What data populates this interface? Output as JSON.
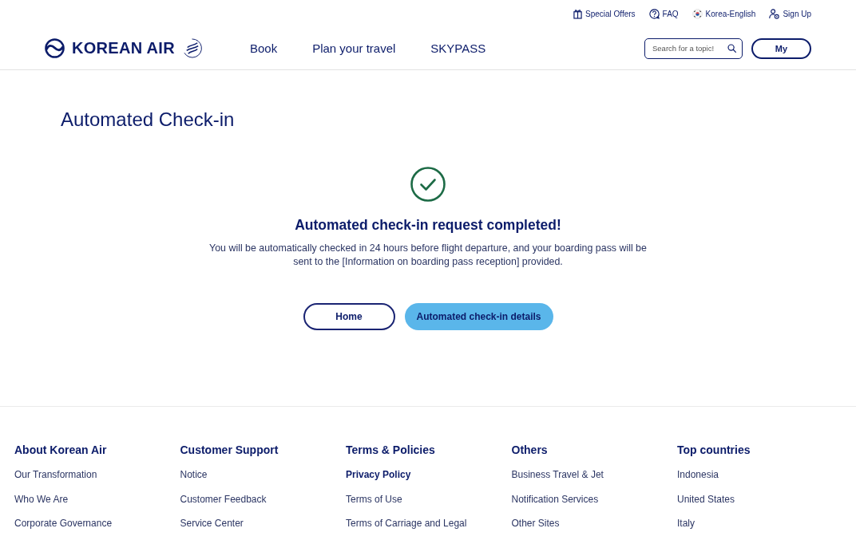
{
  "utility_links": [
    {
      "kind": "offers",
      "label": "Special Offers"
    },
    {
      "kind": "faq",
      "label": "FAQ"
    },
    {
      "kind": "language",
      "label": "Korea-English"
    },
    {
      "kind": "account",
      "label": "Sign Up"
    }
  ],
  "logo": {
    "text": "KOREAN AIR"
  },
  "nav": [
    {
      "label": "Book"
    },
    {
      "label": "Plan your travel"
    },
    {
      "label": "SKYPASS"
    }
  ],
  "search": {
    "placeholder": "Search for a topic!"
  },
  "my_button": {
    "label": "My"
  },
  "page_title": "Automated Check-in",
  "result": {
    "heading": "Automated check-in request completed!",
    "message": "You will be automatically checked in 24 hours before flight departure, and your boarding pass will be sent to the [Information on boarding pass reception] provided."
  },
  "actions": [
    {
      "kind": "outline",
      "label": "Home"
    },
    {
      "kind": "filled",
      "label": "Automated check-in details"
    }
  ],
  "footer": {
    "columns": [
      {
        "heading": "About Korean Air",
        "links": [
          {
            "label": "Our Transformation",
            "bold": false
          },
          {
            "label": "Who We Are",
            "bold": false
          },
          {
            "label": "Corporate Governance",
            "bold": false
          }
        ]
      },
      {
        "heading": "Customer Support",
        "links": [
          {
            "label": "Notice",
            "bold": false
          },
          {
            "label": "Customer Feedback",
            "bold": false
          },
          {
            "label": "Service Center",
            "bold": false
          }
        ]
      },
      {
        "heading": "Terms & Policies",
        "links": [
          {
            "label": "Privacy Policy",
            "bold": true
          },
          {
            "label": "Terms of Use",
            "bold": false
          },
          {
            "label": "Terms of Carriage and Legal",
            "bold": false
          }
        ]
      },
      {
        "heading": "Others",
        "links": [
          {
            "label": "Business Travel & Jet",
            "bold": false
          },
          {
            "label": "Notification Services",
            "bold": false
          },
          {
            "label": "Other Sites",
            "bold": false
          }
        ]
      },
      {
        "heading": "Top countries",
        "links": [
          {
            "label": "Indonesia",
            "bold": false
          },
          {
            "label": "United States",
            "bold": false
          },
          {
            "label": "Italy",
            "bold": false
          }
        ]
      }
    ]
  }
}
